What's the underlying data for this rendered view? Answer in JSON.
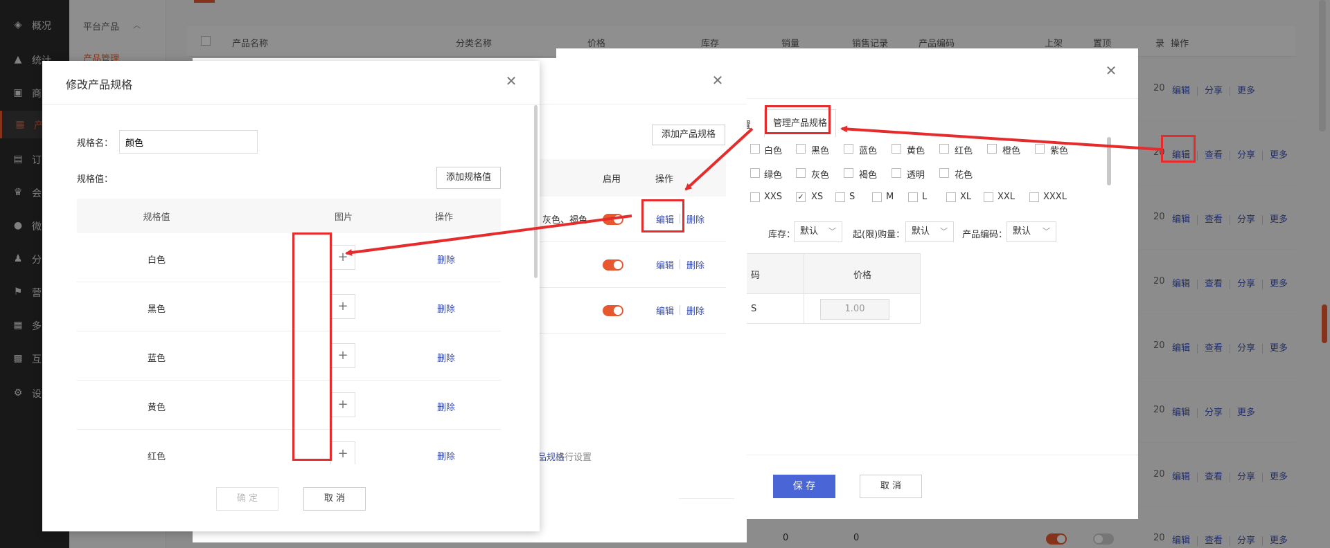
{
  "sidebar": {
    "items": [
      "概况",
      "统计",
      "商",
      "产",
      "订",
      "会",
      "微",
      "分",
      "营",
      "多",
      "互",
      "设"
    ]
  },
  "subnav": {
    "section": "平台产品",
    "active": "产品管理"
  },
  "table": {
    "headers": [
      "产品名称",
      "分类名称",
      "价格",
      "库存",
      "销量",
      "销售记录",
      "产品编码",
      "上架",
      "置顶",
      "录",
      "操作"
    ],
    "row_num": "20",
    "ops": {
      "edit": "编辑",
      "view": "查看",
      "share": "分享",
      "more": "更多"
    },
    "bottom_values": [
      "0",
      "0"
    ]
  },
  "modalC": {
    "manage_spec_tab": "管理产品规格",
    "colors": [
      "白色",
      "黑色",
      "蓝色",
      "黄色",
      "红色",
      "橙色",
      "紫色",
      "绿色",
      "灰色",
      "褐色",
      "透明",
      "花色"
    ],
    "sizes": [
      "XXS",
      "XS",
      "S",
      "M",
      "L",
      "XL",
      "XXL",
      "XXXL"
    ],
    "sizes_checked": [
      "XS"
    ],
    "filters": [
      {
        "label": "库存：",
        "value": "默认"
      },
      {
        "label": "起(限)购量：",
        "value": "默认"
      },
      {
        "label": "产品编码：",
        "value": "默认"
      }
    ],
    "price_header": "价格",
    "price_value": "1.00",
    "code_header_fragment": "码",
    "s_fragment": "S",
    "save": "保 存",
    "cancel": "取 消"
  },
  "modalB": {
    "add_spec": "添加产品规格",
    "col_enable": "启用",
    "col_ops": "操作",
    "row1_values": "灰色、褐色",
    "edit": "编辑",
    "delete": "删除",
    "hint_link": "品规格",
    "hint_text": "进行设置"
  },
  "modalA": {
    "title": "修改产品规格",
    "spec_name_label": "规格名：",
    "spec_name_value": "颜色",
    "spec_values_label": "规格值：",
    "add_value_button": "添加规格值",
    "columns": [
      "规格值",
      "图片",
      "操作"
    ],
    "rows": [
      "白色",
      "黑色",
      "蓝色",
      "黄色",
      "红色"
    ],
    "delete": "删除",
    "plus": "+",
    "confirm": "确 定",
    "cancel": "取 消"
  },
  "colors": {
    "accent": "#e8582f",
    "link": "#3a4eb0",
    "primary": "#4a65d6",
    "annotation": "#e52b2b"
  }
}
